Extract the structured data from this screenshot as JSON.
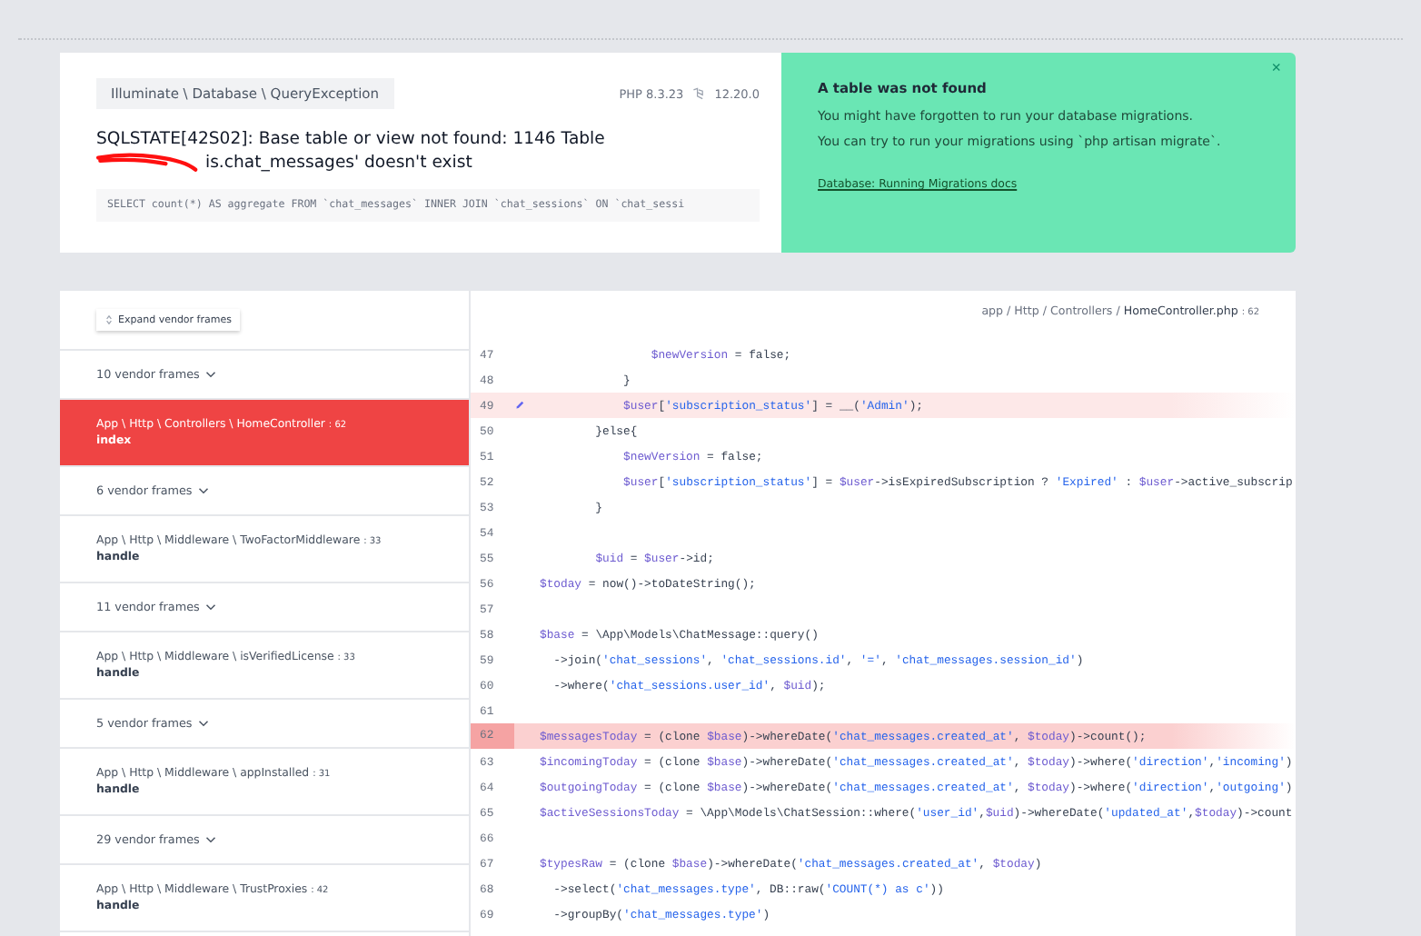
{
  "exception": {
    "class_path": "Illuminate \\ Database \\ QueryException",
    "php_version": "PHP 8.3.23",
    "framework_version": "12.20.0",
    "message_line_1": "SQLSTATE[42S02]: Base table or view not found: 1146 Table",
    "message_line_2": "is.chat_messages' doesn't exist",
    "redacted": true,
    "query": "SELECT count(*) AS aggregate FROM `chat_messages` INNER JOIN `chat_sessions` ON `chat_sessi"
  },
  "solution": {
    "title": "A table was not found",
    "lines": [
      "You might have forgotten to run your database migrations.",
      "You can try to run your migrations using `php artisan migrate`."
    ],
    "link": "Database: Running Migrations docs",
    "close": "×"
  },
  "frames": {
    "expand_button": "Expand vendor frames",
    "items": [
      {
        "kind": "vendor",
        "label": "10 vendor frames",
        "selected": false
      },
      {
        "kind": "frame",
        "path": "App \\ Http \\ Controllers \\ HomeController",
        "line": ": 62",
        "method": "index",
        "selected": true
      },
      {
        "kind": "vendor",
        "label": "6 vendor frames",
        "selected": false
      },
      {
        "kind": "frame",
        "path": "App \\ Http \\ Middleware \\ TwoFactorMiddleware",
        "line": ": 33",
        "method": "handle",
        "selected": false
      },
      {
        "kind": "vendor",
        "label": "11 vendor frames",
        "selected": false
      },
      {
        "kind": "frame",
        "path": "App \\ Http \\ Middleware \\ isVerifiedLicense",
        "line": ": 33",
        "method": "handle",
        "selected": false
      },
      {
        "kind": "vendor",
        "label": "5 vendor frames",
        "selected": false
      },
      {
        "kind": "frame",
        "path": "App \\ Http \\ Middleware \\ appInstalled",
        "line": ": 31",
        "method": "handle",
        "selected": false
      },
      {
        "kind": "vendor",
        "label": "29 vendor frames",
        "selected": false
      },
      {
        "kind": "frame",
        "path": "App \\ Http \\ Middleware \\ TrustProxies",
        "line": ": 42",
        "method": "handle",
        "selected": false
      }
    ]
  },
  "code": {
    "file_dir": "app / Http / Controllers /",
    "file_name": "HomeController.php",
    "file_line": ": 62",
    "lines": [
      {
        "number": "47",
        "text": "                $newVersion = false;",
        "error": false,
        "hovered": false
      },
      {
        "number": "48",
        "text": "            }",
        "error": false,
        "hovered": false
      },
      {
        "number": "49",
        "text": "            $user['subscription_status'] = __('Admin');",
        "error": false,
        "hovered": true
      },
      {
        "number": "50",
        "text": "        }else{",
        "error": false,
        "hovered": false
      },
      {
        "number": "51",
        "text": "            $newVersion = false;",
        "error": false,
        "hovered": false
      },
      {
        "number": "52",
        "text": "            $user['subscription_status'] = $user->isExpiredSubscription ? 'Expired' : $user->active_subscrip",
        "error": false,
        "hovered": false
      },
      {
        "number": "53",
        "text": "        }",
        "error": false,
        "hovered": false
      },
      {
        "number": "54",
        "error": false,
        "hovered": false
      },
      {
        "number": "55",
        "text": "        $uid = $user->id;",
        "error": false,
        "hovered": false
      },
      {
        "number": "56",
        "text": "$today = now()->toDateString();",
        "error": false,
        "hovered": false
      },
      {
        "number": "57",
        "error": false,
        "hovered": false
      },
      {
        "number": "58",
        "text": "$base = \\App\\Models\\ChatMessage::query()",
        "error": false,
        "hovered": false
      },
      {
        "number": "59",
        "text": "  ->join('chat_sessions', 'chat_sessions.id', '=', 'chat_messages.session_id')",
        "error": false,
        "hovered": false
      },
      {
        "number": "60",
        "text": "  ->where('chat_sessions.user_id', $uid);",
        "error": false,
        "hovered": false
      },
      {
        "number": "61",
        "error": false,
        "hovered": false
      },
      {
        "number": "62",
        "text": "$messagesToday = (clone $base)->whereDate('chat_messages.created_at', $today)->count();",
        "error": true,
        "hovered": false
      },
      {
        "number": "63",
        "text": "$incomingToday = (clone $base)->whereDate('chat_messages.created_at', $today)->where('direction','incoming')",
        "error": false,
        "hovered": false
      },
      {
        "number": "64",
        "text": "$outgoingToday = (clone $base)->whereDate('chat_messages.created_at', $today)->where('direction','outgoing')",
        "error": false,
        "hovered": false
      },
      {
        "number": "65",
        "text": "$activeSessionsToday = \\App\\Models\\ChatSession::where('user_id',$uid)->whereDate('updated_at',$today)->count",
        "error": false,
        "hovered": false
      },
      {
        "number": "66",
        "error": false,
        "hovered": false
      },
      {
        "number": "67",
        "text": "$typesRaw = (clone $base)->whereDate('chat_messages.created_at', $today)",
        "error": false,
        "hovered": false
      },
      {
        "number": "68",
        "text": "  ->select('chat_messages.type', DB::raw('COUNT(*) as c'))",
        "error": false,
        "hovered": false
      },
      {
        "number": "69",
        "text": "  ->groupBy('chat_messages.type')",
        "error": false,
        "hovered": false
      }
    ]
  }
}
